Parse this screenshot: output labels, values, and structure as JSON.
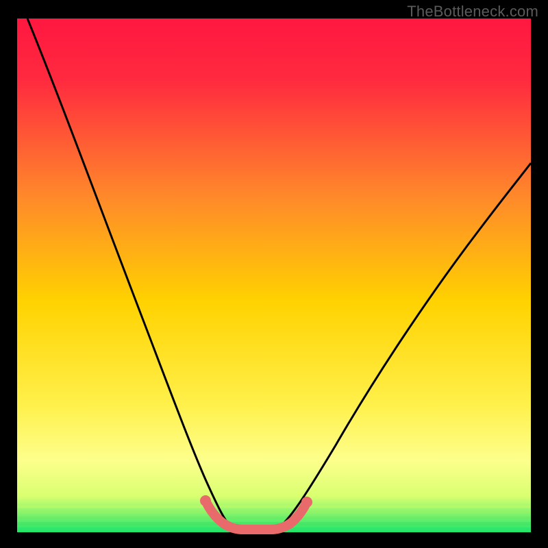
{
  "watermark": "TheBottleneck.com",
  "colors": {
    "black": "#000000",
    "gradient_top": "#ff1a3f",
    "gradient_mid": "#ffd400",
    "gradient_low": "#ffff80",
    "gradient_bottom": "#22e66a",
    "curve": "#000000",
    "accent": "#e86a6a"
  },
  "chart_data": {
    "type": "line",
    "title": "",
    "xlabel": "",
    "ylabel": "",
    "xlim": [
      0,
      100
    ],
    "ylim": [
      0,
      100
    ],
    "series": [
      {
        "name": "v-curve",
        "x": [
          2,
          10,
          18,
          25,
          32,
          35,
          37,
          39,
          41,
          43,
          46,
          50,
          55,
          62,
          70,
          80,
          90,
          100
        ],
        "y": [
          100,
          85,
          68,
          52,
          33,
          22,
          14,
          7,
          2,
          0,
          0,
          0,
          4,
          13,
          25,
          40,
          55,
          68
        ],
        "color": "#000000"
      },
      {
        "name": "highlight-basin",
        "x": [
          34,
          37,
          40,
          42,
          44,
          47,
          50,
          53
        ],
        "y": [
          5,
          2,
          0.5,
          0,
          0,
          0.5,
          1.5,
          4
        ],
        "color": "#e86a6a"
      }
    ],
    "annotations": []
  }
}
